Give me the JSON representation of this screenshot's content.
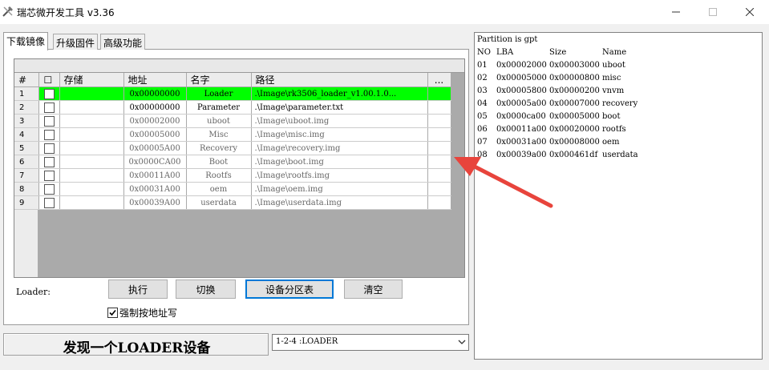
{
  "window": {
    "title": "瑞芯微开发工具 v3.36",
    "minimize_glyph": "—",
    "maximize_glyph": "☐",
    "close_glyph": "✕"
  },
  "tabs": [
    {
      "label": "下载镜像",
      "active": true
    },
    {
      "label": "升级固件",
      "active": false
    },
    {
      "label": "高级功能",
      "active": false
    }
  ],
  "grid": {
    "headers": {
      "num": "#",
      "check": "☐",
      "store": "存储",
      "address": "地址",
      "name": "名字",
      "path": "路径",
      "more": "..."
    },
    "rows": [
      {
        "num": "1",
        "address": "0x00000000",
        "name": "Loader",
        "path": ".\\Image\\rk3506_loader_v1.00.1.0...",
        "selected": true
      },
      {
        "num": "2",
        "address": "0x00000000",
        "name": "Parameter",
        "path": ".\\Image\\parameter.txt"
      },
      {
        "num": "3",
        "address": "0x00002000",
        "name": "uboot",
        "path": ".\\Image\\uboot.img"
      },
      {
        "num": "4",
        "address": "0x00005000",
        "name": "Misc",
        "path": ".\\Image\\misc.img"
      },
      {
        "num": "5",
        "address": "0x00005A00",
        "name": "Recovery",
        "path": ".\\Image\\recovery.img"
      },
      {
        "num": "6",
        "address": "0x0000CA00",
        "name": "Boot",
        "path": ".\\Image\\boot.img"
      },
      {
        "num": "7",
        "address": "0x00011A00",
        "name": "Rootfs",
        "path": ".\\Image\\rootfs.img"
      },
      {
        "num": "8",
        "address": "0x00031A00",
        "name": "oem",
        "path": ".\\Image\\oem.img"
      },
      {
        "num": "9",
        "address": "0x00039A00",
        "name": "userdata",
        "path": ".\\Image\\userdata.img"
      }
    ]
  },
  "controls": {
    "loader_label": "Loader:",
    "execute": "执行",
    "switch": "切换",
    "partition_table": "设备分区表",
    "clear": "清空",
    "force_address_label": "强制按地址写",
    "force_address_checked": true
  },
  "status": {
    "message": "发现一个LOADER设备",
    "device_select_value": "1-2-4 :LOADER"
  },
  "partition_panel": {
    "title": "Partition is gpt",
    "columns": [
      "NO",
      "LBA",
      "Size",
      "Name"
    ],
    "rows": [
      [
        "01",
        "0x00002000",
        "0x00003000",
        "uboot"
      ],
      [
        "02",
        "0x00005000",
        "0x00000800",
        "misc"
      ],
      [
        "03",
        "0x00005800",
        "0x00000200",
        "vnvm"
      ],
      [
        "04",
        "0x00005a00",
        "0x00007000",
        "recovery"
      ],
      [
        "05",
        "0x0000ca00",
        "0x00005000",
        "boot"
      ],
      [
        "06",
        "0x00011a00",
        "0x00020000",
        "rootfs"
      ],
      [
        "07",
        "0x00031a00",
        "0x00008000",
        "oem"
      ],
      [
        "08",
        "0x00039a00",
        "0x000461df",
        "userdata"
      ]
    ]
  },
  "colors": {
    "selected_row": "#00ff00",
    "annotation_arrow": "#e8443c",
    "primary_button_border": "#0078d7"
  }
}
